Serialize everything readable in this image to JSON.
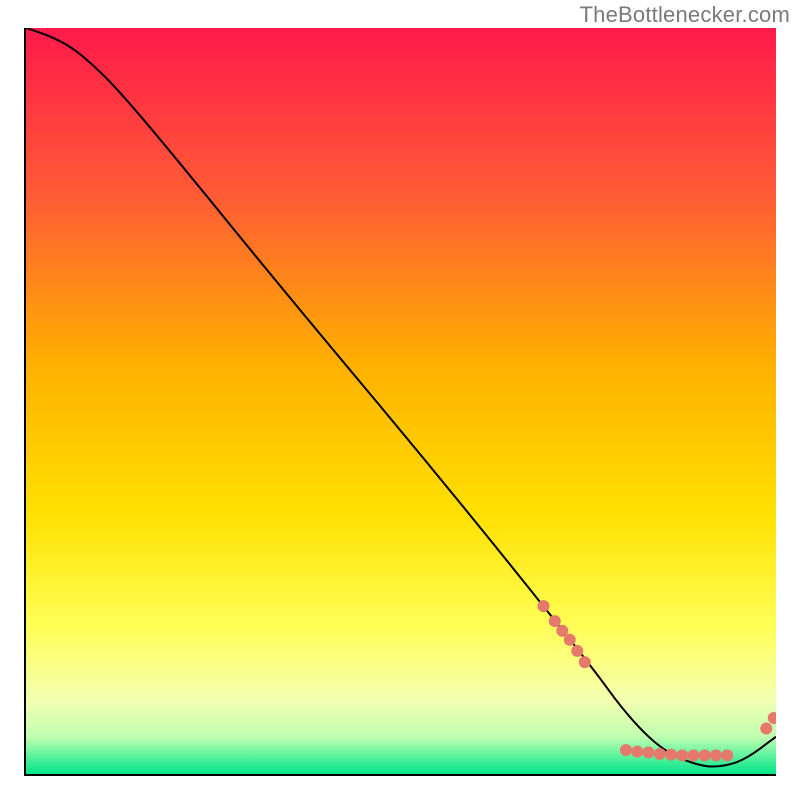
{
  "watermark": "TheBottlenecker.com",
  "chart_data": {
    "type": "line",
    "title": "",
    "xlabel": "",
    "ylabel": "",
    "xlim": [
      0,
      100
    ],
    "ylim": [
      0,
      100
    ],
    "grid": false,
    "background_gradient": {
      "top": "#ff1a4a",
      "mid1": "#ff6a2a",
      "mid2": "#ffd400",
      "mid3": "#ffff66",
      "low": "#e6ffcc",
      "bottom": "#00e68a"
    },
    "series": [
      {
        "name": "bottleneck-curve",
        "color": "#000000",
        "x": [
          0,
          3,
          6,
          9,
          12,
          18,
          35,
          55,
          75,
          80,
          85,
          90,
          93,
          96,
          100
        ],
        "y": [
          100,
          99,
          97.5,
          95,
          92,
          85,
          64,
          40,
          15,
          8,
          3,
          1,
          1,
          2,
          5
        ]
      }
    ],
    "scatter_points": {
      "name": "data-points",
      "color": "#e4796c",
      "radius": 6,
      "points": [
        {
          "x": 69,
          "y": 22.5
        },
        {
          "x": 70.5,
          "y": 20.5
        },
        {
          "x": 71.5,
          "y": 19.2
        },
        {
          "x": 72.5,
          "y": 18
        },
        {
          "x": 73.5,
          "y": 16.5
        },
        {
          "x": 74.5,
          "y": 15
        },
        {
          "x": 80,
          "y": 3.2
        },
        {
          "x": 81.5,
          "y": 3
        },
        {
          "x": 83,
          "y": 2.9
        },
        {
          "x": 84.5,
          "y": 2.7
        },
        {
          "x": 86,
          "y": 2.6
        },
        {
          "x": 87.5,
          "y": 2.5
        },
        {
          "x": 89,
          "y": 2.5
        },
        {
          "x": 90.5,
          "y": 2.5
        },
        {
          "x": 92,
          "y": 2.5
        },
        {
          "x": 93.5,
          "y": 2.5
        },
        {
          "x": 98.7,
          "y": 6.1
        },
        {
          "x": 99.7,
          "y": 7.5
        }
      ]
    }
  }
}
